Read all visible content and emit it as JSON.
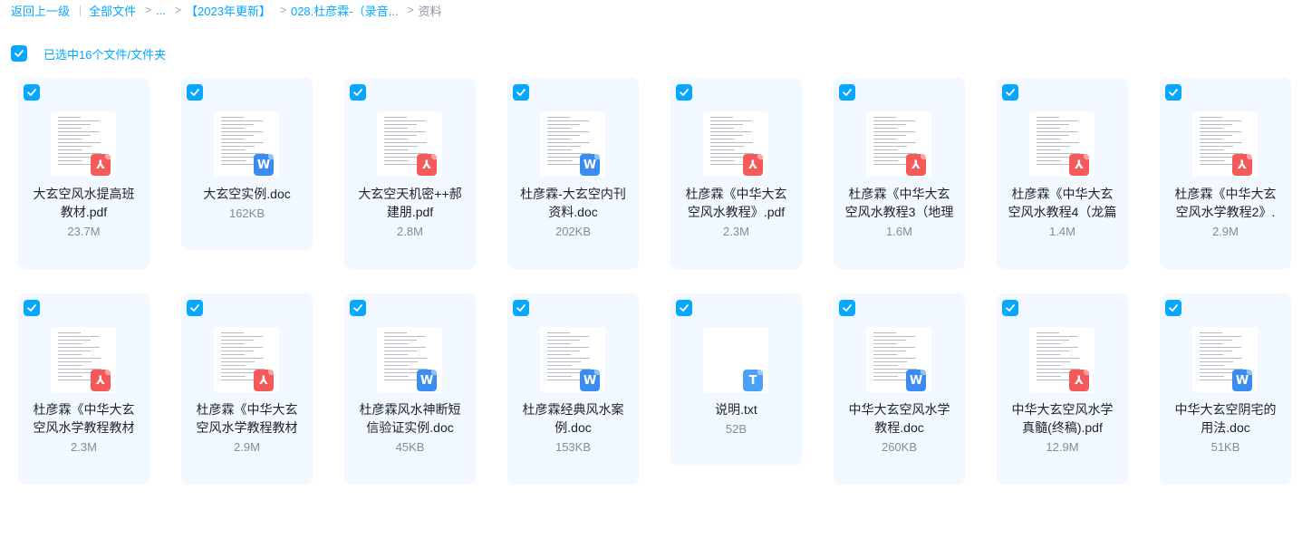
{
  "breadcrumb": {
    "back": "返回上一级",
    "root": "全部文件",
    "ellipsis": "...",
    "level1": "【2023年更新】",
    "level2": "028.杜彦霖-（录音...",
    "current": "资料"
  },
  "selection": {
    "label": "已选中16个文件/文件夹"
  },
  "files": [
    {
      "name": "大玄空风水提高班教材.pdf",
      "size": "23.7M",
      "type": "pdf"
    },
    {
      "name": "大玄空实例.doc",
      "size": "162KB",
      "type": "doc"
    },
    {
      "name": "大玄空天机密++郝建朋.pdf",
      "size": "2.8M",
      "type": "pdf"
    },
    {
      "name": "杜彦霖-大玄空内刊资料.doc",
      "size": "202KB",
      "type": "doc"
    },
    {
      "name": "杜彦霖《中华大玄空风水教程》.pdf",
      "size": "2.3M",
      "type": "pdf"
    },
    {
      "name": "杜彦霖《中华大玄空风水教程3（地理",
      "size": "1.6M",
      "type": "pdf"
    },
    {
      "name": "杜彦霖《中华大玄空风水教程4（龙篇",
      "size": "1.4M",
      "type": "pdf"
    },
    {
      "name": "杜彦霖《中华大玄空风水学教程2》.",
      "size": "2.9M",
      "type": "pdf"
    },
    {
      "name": "杜彦霖《中华大玄空风水学教程教材",
      "size": "2.3M",
      "type": "pdf"
    },
    {
      "name": "杜彦霖《中华大玄空风水学教程教材",
      "size": "2.9M",
      "type": "pdf"
    },
    {
      "name": "杜彦霖风水神断短信验证实例.doc",
      "size": "45KB",
      "type": "doc"
    },
    {
      "name": "杜彦霖经典风水案例.doc",
      "size": "153KB",
      "type": "doc"
    },
    {
      "name": "说明.txt",
      "size": "52B",
      "type": "txt"
    },
    {
      "name": "中华大玄空风水学教程.doc",
      "size": "260KB",
      "type": "doc"
    },
    {
      "name": "中华大玄空风水学真髓(终稿).pdf",
      "size": "12.9M",
      "type": "pdf"
    },
    {
      "name": "中华大玄空阴宅的用法.doc",
      "size": "51KB",
      "type": "doc"
    }
  ],
  "badge_glyphs": {
    "pdf": "⅄",
    "doc": "W",
    "txt": "T"
  },
  "colors": {
    "accent": "#06a7ff",
    "card_bg": "#f1f8ff",
    "pdf": "#f45a5a",
    "doc": "#3b8cf0"
  }
}
